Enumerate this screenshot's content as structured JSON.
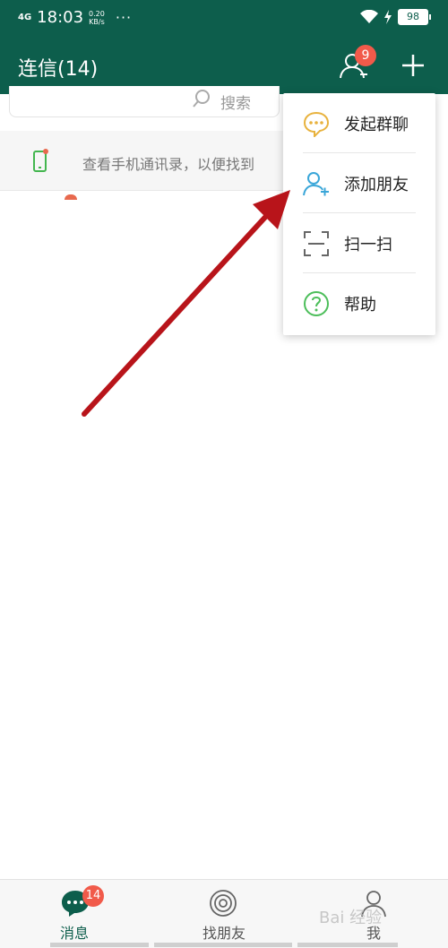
{
  "status_bar": {
    "network": "4G",
    "time": "18:03",
    "speed_value": "0.20",
    "speed_unit": "KB/s",
    "more": "···",
    "battery": "98"
  },
  "header": {
    "title": "连信(14)",
    "contacts_badge": "9"
  },
  "search": {
    "placeholder": "搜索"
  },
  "banner": {
    "text": "查看手机通讯录，以便找到"
  },
  "menu": {
    "items": [
      {
        "label": "发起群聊",
        "icon": "chat-bubble-icon",
        "color": "#e8b23d"
      },
      {
        "label": "添加朋友",
        "icon": "add-friend-icon",
        "color": "#3aa6d8"
      },
      {
        "label": "扫一扫",
        "icon": "scan-icon",
        "color": "#666666"
      },
      {
        "label": "帮助",
        "icon": "help-icon",
        "color": "#4cbe5a"
      }
    ]
  },
  "tabs": [
    {
      "label": "消息",
      "badge": "14",
      "active": true
    },
    {
      "label": "找朋友",
      "active": false
    },
    {
      "label": "我",
      "active": false
    }
  ],
  "watermark": "Bai 经验",
  "colors": {
    "header_bg": "#0d5e4c",
    "badge": "#f15a4a",
    "arrow": "#b8141a"
  }
}
